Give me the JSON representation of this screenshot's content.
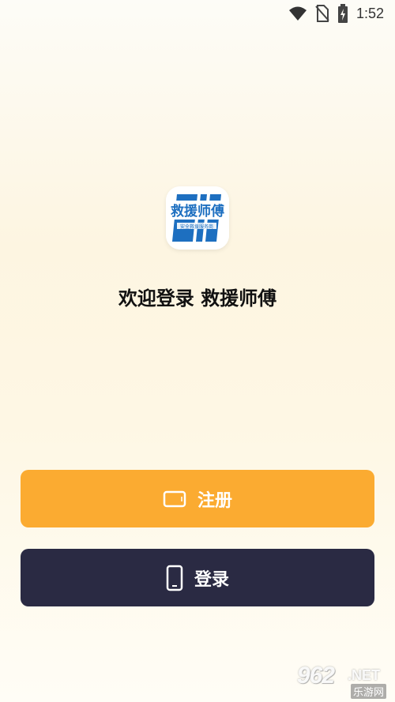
{
  "status_bar": {
    "time": "1:52",
    "icons": [
      "wifi-icon",
      "no-sim-icon",
      "battery-charging-icon"
    ]
  },
  "app": {
    "logo_text": "救援师傅",
    "logo_subtext": "安全救援服务商",
    "welcome_text": "欢迎登录 救援师傅"
  },
  "buttons": {
    "register_label": "注册",
    "register_icon": "tablet-landscape-icon",
    "login_label": "登录",
    "login_icon": "phone-icon"
  },
  "colors": {
    "register_bg": "#fbab31",
    "login_bg": "#2a2a43",
    "logo_blue": "#1d6fc0"
  },
  "watermark": {
    "main": "962",
    "net": ".NET",
    "sub": "乐游网"
  }
}
